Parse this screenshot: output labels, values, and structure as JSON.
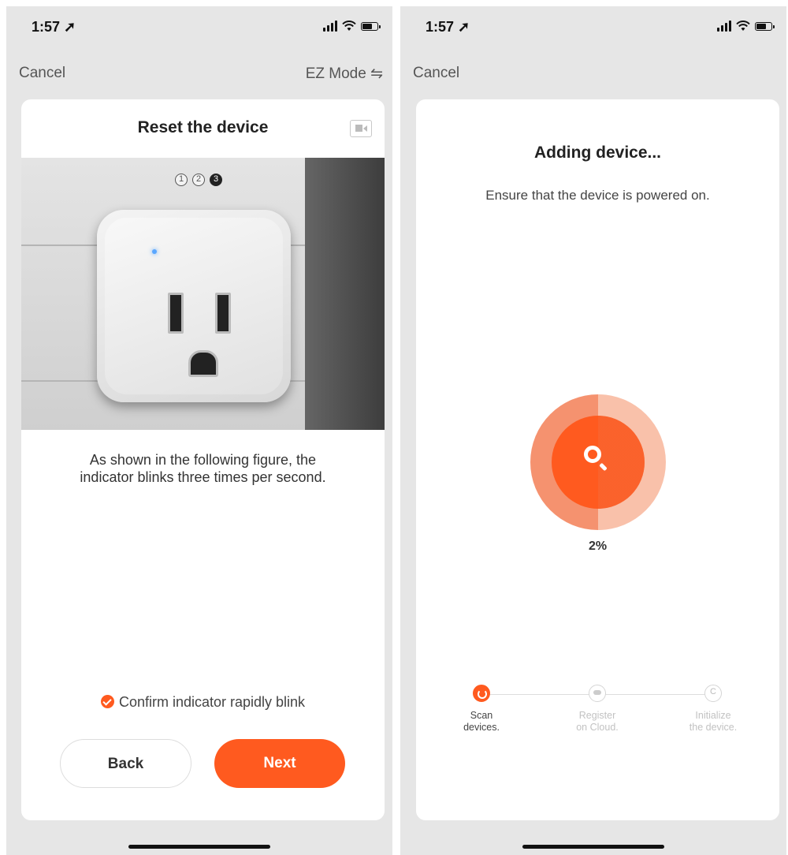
{
  "left_screen": {
    "status": {
      "time": "1:57"
    },
    "nav": {
      "cancel": "Cancel",
      "mode": "EZ Mode ⇋"
    },
    "card": {
      "title": "Reset the device",
      "steps": [
        "1",
        "2",
        "3"
      ],
      "active_step": 3,
      "instruction_line1": "As shown in the following figure, the",
      "instruction_line2": "indicator blinks three times per second.",
      "confirm_label": "Confirm indicator rapidly blink",
      "confirm_checked": true,
      "back_button": "Back",
      "next_button": "Next"
    }
  },
  "right_screen": {
    "status": {
      "time": "1:57"
    },
    "nav": {
      "cancel": "Cancel"
    },
    "card": {
      "title": "Adding device...",
      "subtitle": "Ensure that the device is powered on.",
      "progress_percent": 2,
      "progress_text": "2%",
      "progress_steps": [
        {
          "line1": "Scan",
          "line2": "devices.",
          "state": "active",
          "icon": "spinner-icon"
        },
        {
          "line1": "Register",
          "line2": "on Cloud.",
          "state": "pending",
          "icon": "cloud-icon"
        },
        {
          "line1": "Initialize",
          "line2": "the device.",
          "state": "pending",
          "icon": "c-icon"
        }
      ]
    }
  },
  "colors": {
    "accent": "#ff5a1f",
    "background": "#e6e6e6",
    "card": "#ffffff"
  }
}
